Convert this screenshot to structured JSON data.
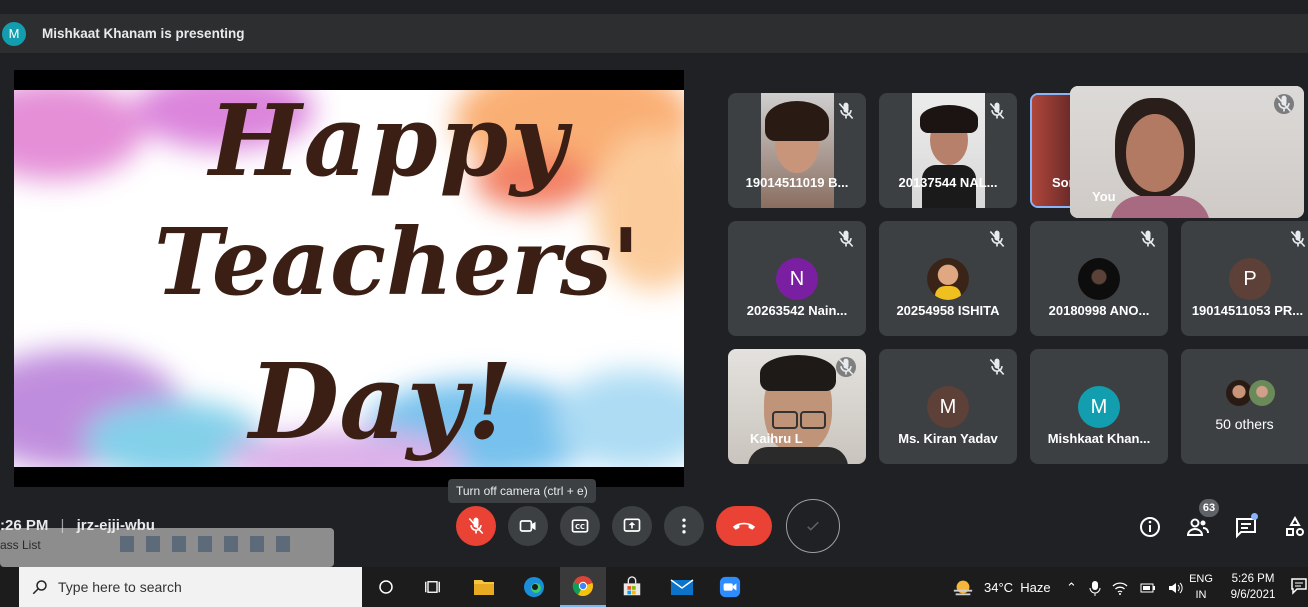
{
  "presenter_banner": {
    "avatar_letter": "M",
    "text": "Mishkaat Khanam is presenting"
  },
  "slide": {
    "line1": "Happy",
    "line2": "Teachers'",
    "line3": "Day!"
  },
  "participants": [
    {
      "name": "19014511019 B...",
      "type": "video",
      "muted": true
    },
    {
      "name": "20137544 NAL...",
      "type": "video",
      "muted": true
    },
    {
      "name": "Son",
      "type": "video",
      "muted": false
    },
    {
      "name": "You",
      "type": "self-video",
      "muted": true
    },
    {
      "name": "20263542 Nain...",
      "type": "avatar",
      "letter": "N",
      "color": "#7b1fa2",
      "muted": true
    },
    {
      "name": "20254958 ISHITA",
      "type": "photo",
      "muted": true
    },
    {
      "name": "20180998 ANO...",
      "type": "photo",
      "muted": true
    },
    {
      "name": "19014511053 PR...",
      "type": "avatar",
      "letter": "P",
      "color": "#5d4037",
      "muted": true
    },
    {
      "name": "Kaihru L",
      "type": "video",
      "muted": true
    },
    {
      "name": "Ms. Kiran Yadav",
      "type": "avatar",
      "letter": "M",
      "color": "#5d4037",
      "muted": true
    },
    {
      "name": "Mishkaat Khan...",
      "type": "avatar",
      "letter": "M",
      "color": "#129eaf",
      "muted": false
    },
    {
      "name": "50 others",
      "type": "others",
      "muted": false
    }
  ],
  "tooltip": "Turn off camera (ctrl + e)",
  "meeting": {
    "time": ":26 PM",
    "separator": "|",
    "code": "jrz-ejji-wbu"
  },
  "background_window": {
    "label": "ass List"
  },
  "controls": {
    "mic": "mic-off-icon",
    "camera": "camera-icon",
    "captions": "captions-icon",
    "present": "present-icon",
    "more": "more-icon",
    "end_call": "end-call-icon",
    "reaction": "check-icon"
  },
  "side_controls": {
    "people_count": "63"
  },
  "taskbar": {
    "search_placeholder": "Type here to search",
    "weather": "34°C  Haze",
    "language_line1": "ENG",
    "language_line2": "IN",
    "time": "5:26 PM",
    "date": "9/6/2021"
  },
  "colors": {
    "accent_red": "#ea4335",
    "background": "#202124",
    "tile": "#3c4043"
  }
}
